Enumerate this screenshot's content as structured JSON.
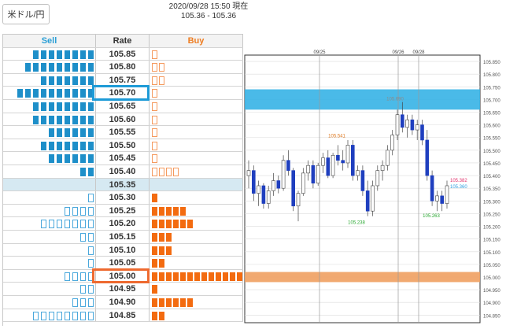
{
  "pair": {
    "label": "米ドル/円"
  },
  "header": {
    "datetime": "2020/09/28 15:50 現在",
    "quote": "105.36 - 105.36"
  },
  "board": {
    "headers": {
      "sell": "Sell",
      "rate": "Rate",
      "buy": "Buy"
    },
    "rows": [
      {
        "rate": "105.85",
        "sell_filled": 8,
        "sell_empty": 0,
        "buy_filled": 0,
        "buy_empty": 1
      },
      {
        "rate": "105.80",
        "sell_filled": 9,
        "sell_empty": 0,
        "buy_filled": 0,
        "buy_empty": 2
      },
      {
        "rate": "105.75",
        "sell_filled": 7,
        "sell_empty": 0,
        "buy_filled": 0,
        "buy_empty": 2
      },
      {
        "rate": "105.70",
        "sell_filled": 10,
        "sell_empty": 0,
        "buy_filled": 0,
        "buy_empty": 1
      },
      {
        "rate": "105.65",
        "sell_filled": 8,
        "sell_empty": 0,
        "buy_filled": 0,
        "buy_empty": 1
      },
      {
        "rate": "105.60",
        "sell_filled": 8,
        "sell_empty": 0,
        "buy_filled": 0,
        "buy_empty": 1
      },
      {
        "rate": "105.55",
        "sell_filled": 6,
        "sell_empty": 0,
        "buy_filled": 0,
        "buy_empty": 1
      },
      {
        "rate": "105.50",
        "sell_filled": 7,
        "sell_empty": 0,
        "buy_filled": 0,
        "buy_empty": 1
      },
      {
        "rate": "105.45",
        "sell_filled": 6,
        "sell_empty": 0,
        "buy_filled": 0,
        "buy_empty": 1
      },
      {
        "rate": "105.40",
        "sell_filled": 2,
        "sell_empty": 0,
        "buy_filled": 0,
        "buy_empty": 4
      },
      {
        "rate": "105.35",
        "mid": true,
        "sell_filled": 0,
        "sell_empty": 0,
        "buy_filled": 0,
        "buy_empty": 0
      },
      {
        "rate": "105.30",
        "sell_filled": 0,
        "sell_empty": 1,
        "buy_filled": 1,
        "buy_empty": 0
      },
      {
        "rate": "105.25",
        "sell_filled": 0,
        "sell_empty": 4,
        "buy_filled": 5,
        "buy_empty": 0
      },
      {
        "rate": "105.20",
        "sell_filled": 0,
        "sell_empty": 7,
        "buy_filled": 6,
        "buy_empty": 0
      },
      {
        "rate": "105.15",
        "sell_filled": 0,
        "sell_empty": 2,
        "buy_filled": 3,
        "buy_empty": 0
      },
      {
        "rate": "105.10",
        "sell_filled": 0,
        "sell_empty": 1,
        "buy_filled": 3,
        "buy_empty": 0
      },
      {
        "rate": "105.05",
        "sell_filled": 0,
        "sell_empty": 1,
        "buy_filled": 2,
        "buy_empty": 0
      },
      {
        "rate": "105.00",
        "sell_filled": 0,
        "sell_empty": 4,
        "buy_filled": 13,
        "buy_empty": 0
      },
      {
        "rate": "104.95",
        "sell_filled": 0,
        "sell_empty": 2,
        "buy_filled": 1,
        "buy_empty": 0
      },
      {
        "rate": "104.90",
        "sell_filled": 0,
        "sell_empty": 3,
        "buy_filled": 6,
        "buy_empty": 0
      },
      {
        "rate": "104.85",
        "sell_filled": 0,
        "sell_empty": 8,
        "buy_filled": 2,
        "buy_empty": 0
      }
    ],
    "highlight_sell_rate": "105.70",
    "highlight_buy_rate": "105.00"
  },
  "colors": {
    "sell": "#1e8fc9",
    "buy": "#f36b10",
    "mid": "#d6e9f2"
  },
  "chart_data": {
    "type": "candlestick",
    "x_labels": [
      "09/25",
      "09/26",
      "09/28"
    ],
    "y_ticks": [
      "105.850",
      "105.800",
      "105.750",
      "105.700",
      "105.650",
      "105.600",
      "105.550",
      "105.500",
      "105.450",
      "105.400",
      "105.350",
      "105.300",
      "105.250",
      "105.200",
      "105.150",
      "105.100",
      "105.050",
      "105.000",
      "104.950",
      "104.900",
      "104.850"
    ],
    "ylim": [
      104.82,
      105.875
    ],
    "bands": [
      {
        "low": 105.66,
        "high": 105.74,
        "color": "#36b2e6"
      },
      {
        "low": 104.98,
        "high": 105.02,
        "color": "#f0a060"
      }
    ],
    "annotations": [
      {
        "text": "105.690",
        "value": 105.69,
        "color": "#8a8a8a"
      },
      {
        "text": "105.541",
        "value": 105.541,
        "color": "#e07a20"
      },
      {
        "text": "105.238",
        "value": 105.238,
        "color": "#2aa832"
      },
      {
        "text": "105.263",
        "value": 105.263,
        "color": "#2aa832"
      },
      {
        "text": "105.382",
        "value": 105.382,
        "color": "#e0306a"
      },
      {
        "text": "105.360",
        "value": 105.36,
        "color": "#30a0e0"
      }
    ],
    "candles": [
      [
        105.4,
        105.46,
        105.35,
        105.42
      ],
      [
        105.42,
        105.44,
        105.3,
        105.33
      ],
      [
        105.33,
        105.38,
        105.28,
        105.36
      ],
      [
        105.36,
        105.37,
        105.27,
        105.29
      ],
      [
        105.29,
        105.36,
        105.27,
        105.34
      ],
      [
        105.34,
        105.41,
        105.32,
        105.38
      ],
      [
        105.38,
        105.4,
        105.33,
        105.35
      ],
      [
        105.35,
        105.48,
        105.34,
        105.46
      ],
      [
        105.46,
        105.5,
        105.4,
        105.42
      ],
      [
        105.42,
        105.43,
        105.26,
        105.28
      ],
      [
        105.28,
        105.34,
        105.22,
        105.33
      ],
      [
        105.33,
        105.43,
        105.32,
        105.41
      ],
      [
        105.41,
        105.46,
        105.38,
        105.44
      ],
      [
        105.44,
        105.46,
        105.35,
        105.37
      ],
      [
        105.37,
        105.45,
        105.36,
        105.44
      ],
      [
        105.44,
        105.49,
        105.41,
        105.47
      ],
      [
        105.47,
        105.5,
        105.39,
        105.4
      ],
      [
        105.4,
        105.49,
        105.39,
        105.48
      ],
      [
        105.48,
        105.52,
        105.44,
        105.46
      ],
      [
        105.46,
        105.5,
        105.42,
        105.45
      ],
      [
        105.45,
        105.54,
        105.43,
        105.52
      ],
      [
        105.52,
        105.54,
        105.38,
        105.4
      ],
      [
        105.4,
        105.44,
        105.38,
        105.42
      ],
      [
        105.42,
        105.44,
        105.32,
        105.34
      ],
      [
        105.34,
        105.38,
        105.24,
        105.26
      ],
      [
        105.26,
        105.38,
        105.24,
        105.36
      ],
      [
        105.36,
        105.44,
        105.34,
        105.42
      ],
      [
        105.42,
        105.46,
        105.38,
        105.44
      ],
      [
        105.44,
        105.52,
        105.42,
        105.5
      ],
      [
        105.5,
        105.58,
        105.48,
        105.56
      ],
      [
        105.56,
        105.66,
        105.54,
        105.64
      ],
      [
        105.64,
        105.69,
        105.57,
        105.59
      ],
      [
        105.59,
        105.64,
        105.55,
        105.62
      ],
      [
        105.62,
        105.64,
        105.56,
        105.58
      ],
      [
        105.58,
        105.62,
        105.54,
        105.6
      ],
      [
        105.6,
        105.62,
        105.52,
        105.54
      ],
      [
        105.54,
        105.58,
        105.38,
        105.4
      ],
      [
        105.4,
        105.42,
        105.28,
        105.3
      ],
      [
        105.3,
        105.34,
        105.26,
        105.32
      ],
      [
        105.32,
        105.34,
        105.26,
        105.29
      ],
      [
        105.29,
        105.38,
        105.27,
        105.36
      ]
    ]
  }
}
